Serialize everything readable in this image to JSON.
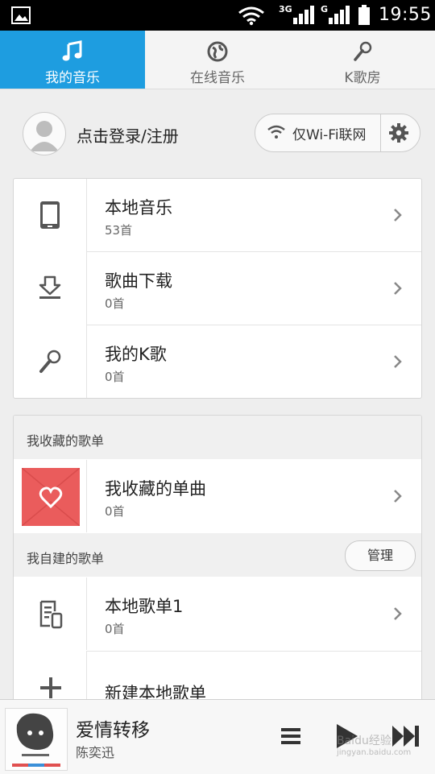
{
  "status_bar": {
    "time": "19:55",
    "network_1": "3G",
    "network_2": "G"
  },
  "tabs": [
    {
      "label": "我的音乐",
      "icon": "music-note-icon",
      "active": true
    },
    {
      "label": "在线音乐",
      "icon": "globe-icon",
      "active": false
    },
    {
      "label": "K歌房",
      "icon": "microphone-icon",
      "active": false
    }
  ],
  "account": {
    "login_label": "点击登录/注册",
    "wifi_only_label": "仅Wi-Fi联网"
  },
  "library": [
    {
      "title": "本地音乐",
      "count": "53首",
      "icon": "phone-icon"
    },
    {
      "title": "歌曲下载",
      "count": "0首",
      "icon": "download-icon"
    },
    {
      "title": "我的K歌",
      "count": "0首",
      "icon": "microphone-icon"
    }
  ],
  "favorites": {
    "section_label": "我收藏的歌单",
    "item": {
      "title": "我收藏的单曲",
      "count": "0首",
      "icon": "heart-icon"
    }
  },
  "my_playlists": {
    "section_label": "我自建的歌单",
    "manage_label": "管理",
    "items": [
      {
        "title": "本地歌单1",
        "count": "0首",
        "icon": "playlist-doc-icon"
      },
      {
        "title": "新建本地歌单",
        "icon": "plus-icon"
      }
    ]
  },
  "player": {
    "song_title": "爱情转移",
    "artist": "陈奕迅"
  },
  "watermark": {
    "line1": "Baidu经验",
    "line2": "jingyan.baidu.com"
  },
  "colors": {
    "accent": "#1e9de0",
    "favorite_cover": "#ea5c5c"
  }
}
